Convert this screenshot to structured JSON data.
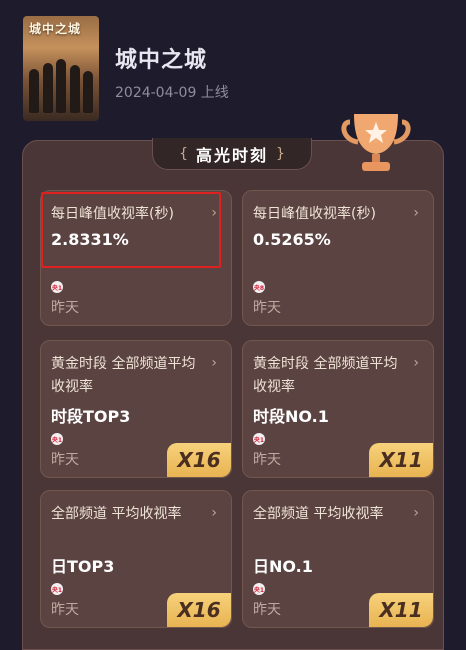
{
  "header": {
    "poster_text": "城中之城",
    "title": "城中之城",
    "date": "2024-04-09 上线"
  },
  "section": {
    "bracket_left": "{",
    "title": "高光时刻",
    "bracket_right": "}"
  },
  "channel_icon_text": "央1",
  "channel_icon_text_8": "央8",
  "cards": [
    {
      "title": "每日峰值收视率(秒)",
      "value": "2.8331%",
      "when": "昨天",
      "badge": ""
    },
    {
      "title": "每日峰值收视率(秒)",
      "value": "0.5265%",
      "when": "昨天",
      "badge": ""
    },
    {
      "title": "黄金时段 全部频道平均收视率",
      "value": "时段TOP3",
      "when": "昨天",
      "badge": "X16"
    },
    {
      "title": "黄金时段 全部频道平均收视率",
      "value": "时段NO.1",
      "when": "昨天",
      "badge": "X11"
    },
    {
      "title": "全部频道 平均收视率",
      "value": "日TOP3",
      "when": "昨天",
      "badge": "X16"
    },
    {
      "title": "全部频道 平均收视率",
      "value": "日NO.1",
      "when": "昨天",
      "badge": "X11"
    }
  ],
  "colors": {
    "background": "#1e1c2c",
    "panel": "#4a3637",
    "card": "#5b4342",
    "badge": "#f2c56a",
    "highlight": "#e02020"
  }
}
